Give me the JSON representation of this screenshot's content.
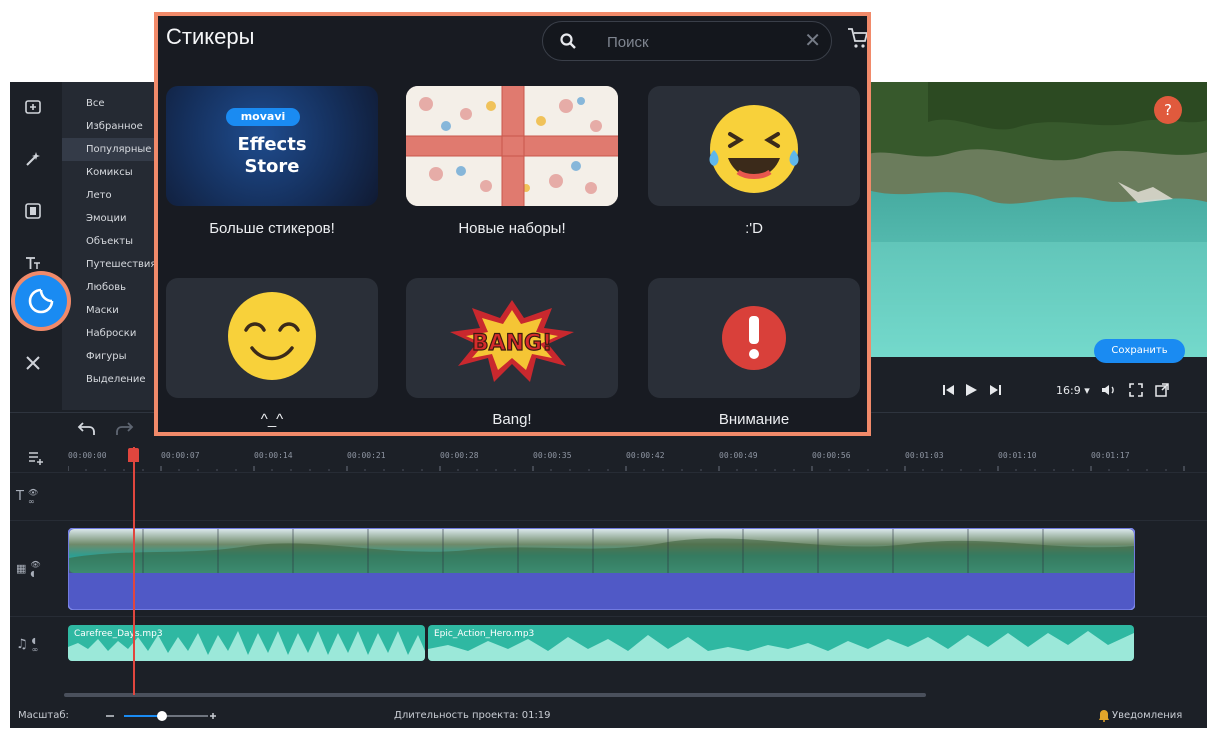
{
  "sidebar": {
    "categories": [
      "Все",
      "Избранное",
      "Популярные",
      "Комиксы",
      "Лето",
      "Эмоции",
      "Объекты",
      "Путешествия",
      "Любовь",
      "Маски",
      "Наброски",
      "Фигуры",
      "Выделение"
    ],
    "active_category": "Популярные"
  },
  "sticker_panel": {
    "title": "Стикеры",
    "search_placeholder": "Поиск",
    "cards": [
      {
        "label": "Больше стикеров!",
        "kind": "store",
        "logo_text": "movavi",
        "line1": "Effects",
        "line2": "Store"
      },
      {
        "label": "Новые наборы!",
        "kind": "gift"
      },
      {
        "label": ":'D",
        "kind": "laughing-emoji"
      },
      {
        "label": "^_^",
        "kind": "smile-emoji"
      },
      {
        "label": "Bang!",
        "kind": "bang"
      },
      {
        "label": "Внимание",
        "kind": "warning"
      }
    ]
  },
  "player": {
    "aspect_ratio": "16:9 ▾",
    "help": "?"
  },
  "toolbar": {
    "save_label": "Сохранить"
  },
  "timeline": {
    "ruler": [
      "00:00:00",
      "00:00:07",
      "00:00:14",
      "00:00:21",
      "00:00:28",
      "00:00:35",
      "00:00:42",
      "00:00:49",
      "00:00:56",
      "00:01:03",
      "00:01:10",
      "00:01:17"
    ],
    "audio_clips": [
      "Carefree_Days.mp3",
      "Epic_Action_Hero.mp3"
    ]
  },
  "status": {
    "scale_label": "Масштаб:",
    "duration": "Длительность проекта: 01:19",
    "notifications": "Уведомления"
  },
  "colors": {
    "accent": "#1a8bf2",
    "highlight_border": "#f18a6a",
    "playhead": "#e0463e",
    "video_track": "#5059c6",
    "audio_track": "#2fb8a2"
  }
}
